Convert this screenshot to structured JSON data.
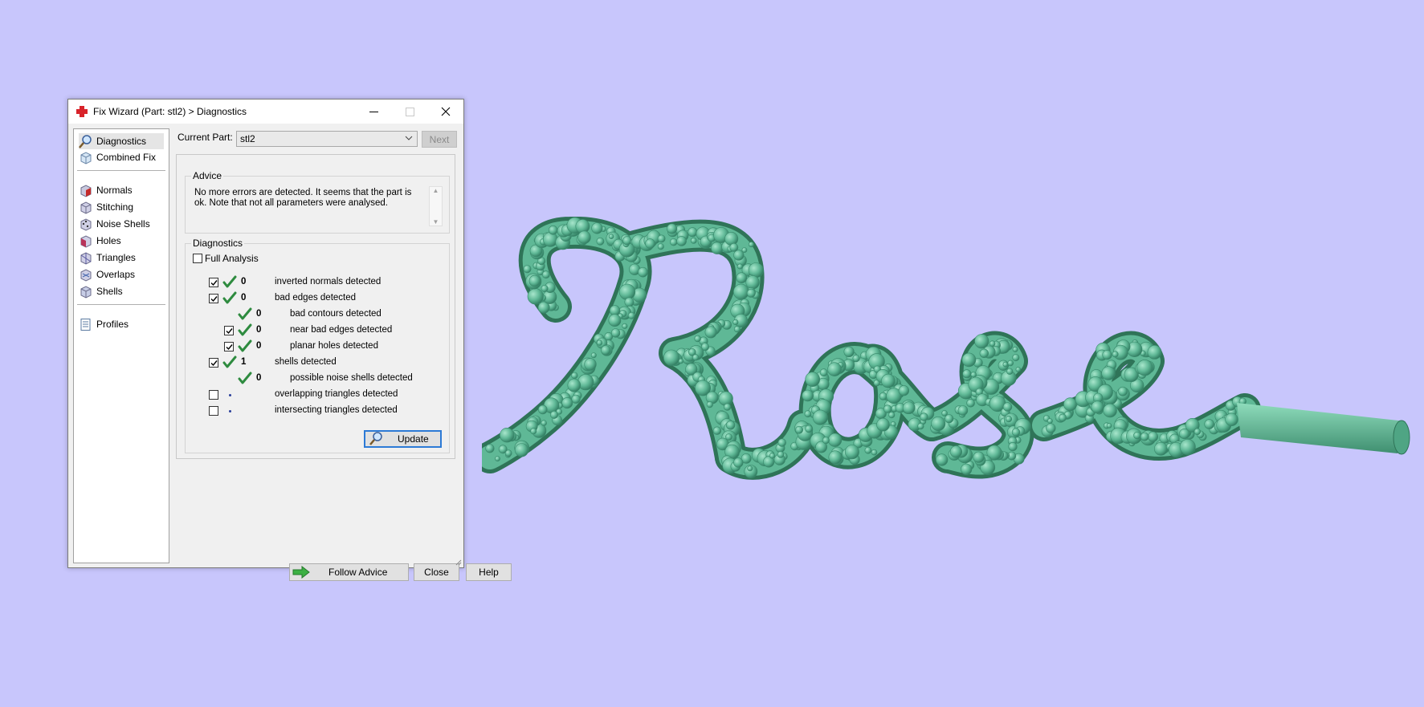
{
  "dialog": {
    "title": "Fix Wizard (Part: stl2) > Diagnostics",
    "window_controls": [
      "minimize-icon",
      "maximize-icon",
      "close-icon"
    ]
  },
  "nav": {
    "group1": [
      {
        "label": "Diagnostics",
        "icon": "magnifier-icon",
        "selected": true
      },
      {
        "label": "Combined Fix",
        "icon": "cube-icon"
      }
    ],
    "group2": [
      {
        "label": "Normals",
        "icon": "normals-cube-icon"
      },
      {
        "label": "Stitching",
        "icon": "stitching-cube-icon"
      },
      {
        "label": "Noise Shells",
        "icon": "noise-shells-cube-icon"
      },
      {
        "label": "Holes",
        "icon": "holes-cube-icon"
      },
      {
        "label": "Triangles",
        "icon": "triangles-cube-icon"
      },
      {
        "label": "Overlaps",
        "icon": "overlaps-cube-icon"
      },
      {
        "label": "Shells",
        "icon": "shells-cube-icon"
      }
    ],
    "group3": [
      {
        "label": "Profiles",
        "icon": "document-icon"
      }
    ]
  },
  "current_part": {
    "label": "Current Part:",
    "value": "stl2",
    "next_label": "Next"
  },
  "advice": {
    "title": "Advice",
    "text": "No more errors are detected. It seems that the part is ok. Note that not all parameters were analysed."
  },
  "diagnostics": {
    "title": "Diagnostics",
    "full_analysis_label": "Full Analysis",
    "full_analysis_checked": false,
    "rows": [
      {
        "checked": true,
        "has_checkbox": true,
        "status": "ok",
        "count": "0",
        "label": "inverted normals detected",
        "indent": 0
      },
      {
        "checked": true,
        "has_checkbox": true,
        "status": "ok",
        "count": "0",
        "label": "bad edges detected",
        "indent": 0
      },
      {
        "checked": false,
        "has_checkbox": false,
        "status": "ok",
        "count": "0",
        "label": "bad contours detected",
        "indent": 1
      },
      {
        "checked": true,
        "has_checkbox": true,
        "status": "ok",
        "count": "0",
        "label": "near bad edges detected",
        "indent": 1
      },
      {
        "checked": true,
        "has_checkbox": true,
        "status": "ok",
        "count": "0",
        "label": "planar holes detected",
        "indent": 1
      },
      {
        "checked": true,
        "has_checkbox": true,
        "status": "ok",
        "count": "1",
        "label": "shells detected",
        "indent": 0
      },
      {
        "checked": false,
        "has_checkbox": false,
        "status": "ok",
        "count": "0",
        "label": "possible noise shells detected",
        "indent": 1
      },
      {
        "checked": false,
        "has_checkbox": true,
        "status": "none",
        "count": "",
        "label": "overlapping triangles detected",
        "indent": 0
      },
      {
        "checked": false,
        "has_checkbox": true,
        "status": "none",
        "count": "",
        "label": "intersecting triangles detected",
        "indent": 0
      }
    ],
    "update_label": "Update"
  },
  "buttons": {
    "follow_advice": "Follow Advice",
    "close": "Close",
    "help": "Help"
  },
  "colors": {
    "viewport_background": "#c8c6fc",
    "model_color": "#5fb896",
    "check_green": "#2e8b3f"
  }
}
